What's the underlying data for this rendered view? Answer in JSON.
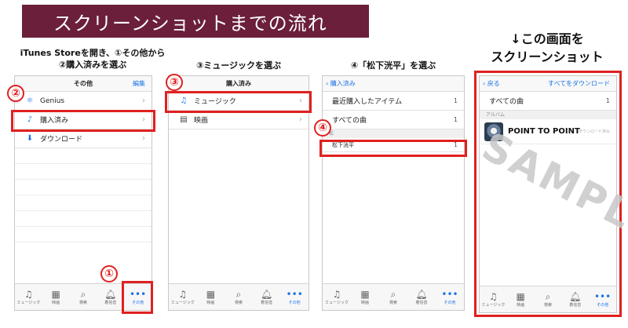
{
  "title": "スクリーンショットまでの流れ",
  "captions": {
    "step1_line1": "iTunes Storeを開き、①その他から",
    "step1_line2": "②購入済みを選ぶ",
    "step3": "③ミュージックを選ぶ",
    "step4": "④「松下洸平」を選ぶ",
    "right_line1": "↓この画面を",
    "right_line2": "スクリーンショット"
  },
  "markers": {
    "m1": "①",
    "m2": "②",
    "m3": "③",
    "m4": "④"
  },
  "screen1": {
    "nav_title": "その他",
    "nav_edit": "編集",
    "rows": [
      {
        "icon": "genius-icon",
        "glyph": "⚛",
        "label": "Genius"
      },
      {
        "icon": "purchased-icon",
        "glyph": "♪",
        "label": "購入済み"
      },
      {
        "icon": "download-icon",
        "glyph": "⬇",
        "label": "ダウンロード"
      }
    ]
  },
  "screen2": {
    "nav_title": "購入済み",
    "rows": [
      {
        "icon": "music-note-icon",
        "glyph": "♫",
        "label": "ミュージック"
      },
      {
        "icon": "film-icon",
        "glyph": "▤",
        "label": "映画"
      }
    ]
  },
  "screen3": {
    "back_label": "購入済み",
    "rows": [
      {
        "label": "最近購入したアイテム",
        "count": "1"
      },
      {
        "label": "すべての曲",
        "count": "1"
      }
    ],
    "section": "松",
    "artist": "松下洸平",
    "artist_count": "1"
  },
  "screen4": {
    "back_label": "戻る",
    "download_all": "すべてをダウンロード",
    "all_songs": "すべての曲",
    "all_songs_count": "1",
    "section": "アルバム",
    "album_title": "POINT TO POINT",
    "album_dl": "ダウンロード済み"
  },
  "tabs": [
    {
      "icon": "music-tab-icon",
      "glyph": "♫",
      "label": "ミュージック"
    },
    {
      "icon": "movie-tab-icon",
      "glyph": "▦",
      "label": "映画"
    },
    {
      "icon": "search-tab-icon",
      "glyph": "⌕",
      "label": "検索"
    },
    {
      "icon": "bell-tab-icon",
      "glyph": "🔔︎",
      "label": "着信音"
    },
    {
      "icon": "more-tab-icon",
      "glyph": "•••",
      "label": "その他"
    }
  ],
  "watermark": "SAMPLE",
  "colors": {
    "banner": "#6b1f3b",
    "highlight": "#e02020",
    "accent": "#1a73e8"
  }
}
